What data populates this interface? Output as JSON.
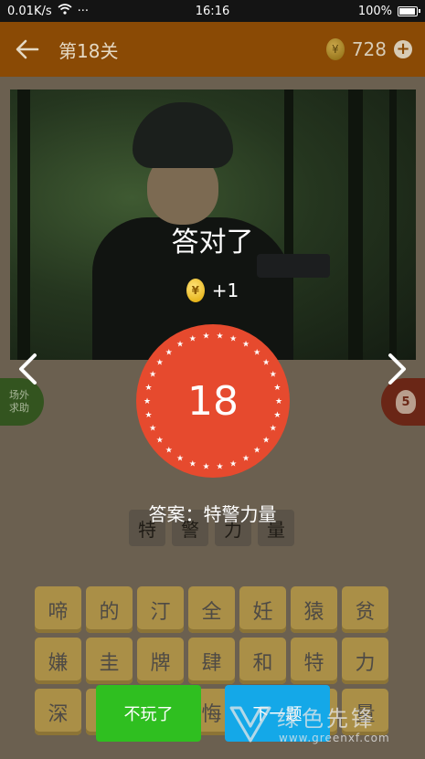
{
  "status_bar": {
    "network_speed": "0.01K/s",
    "more_dots": "···",
    "time": "16:16",
    "battery_percent": "100%",
    "battery_level": 1.0
  },
  "header": {
    "level_title": "第18关",
    "coin_count": "728",
    "coin_symbol": "¥"
  },
  "question": {
    "answer_chars": [
      "特",
      "警",
      "力",
      "量"
    ]
  },
  "sidebar": {
    "help_label": "场外\n求助",
    "hint_count": "5"
  },
  "character_grid": [
    [
      "啼",
      "的",
      "汀",
      "全",
      "妊",
      "猿",
      "贫"
    ],
    [
      "嫌",
      "圭",
      "牌",
      "肆",
      "和",
      "特",
      "力"
    ],
    [
      "深",
      "",
      "",
      "悔",
      "",
      "",
      "量"
    ]
  ],
  "result_overlay": {
    "title": "答对了",
    "reward_symbol": "¥",
    "reward": "+1",
    "level_number": "18",
    "answer_text": "答案：特警力量",
    "quit_label": "不玩了",
    "next_label": "下一题"
  },
  "watermark": {
    "main": "绿色先锋",
    "sub": "www.greenxf.com"
  },
  "colors": {
    "appbar": "#8a4a05",
    "badge_red": "#e64a2e",
    "quit_green": "#2fbf20",
    "next_blue": "#14a8e8",
    "tile": "#aa8f47"
  }
}
